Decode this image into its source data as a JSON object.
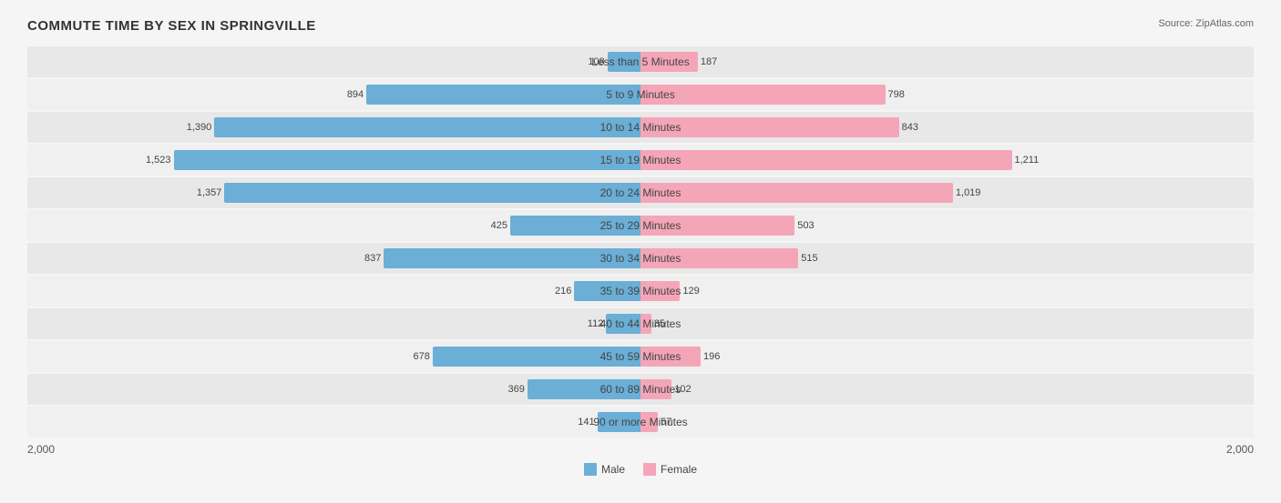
{
  "title": "COMMUTE TIME BY SEX IN SPRINGVILLE",
  "source": "Source: ZipAtlas.com",
  "maxValue": 2000,
  "leftAxisLabel": "2,000",
  "rightAxisLabel": "2,000",
  "legendMale": "Male",
  "legendFemale": "Female",
  "rows": [
    {
      "label": "Less than 5 Minutes",
      "male": 108,
      "female": 187
    },
    {
      "label": "5 to 9 Minutes",
      "male": 894,
      "female": 798
    },
    {
      "label": "10 to 14 Minutes",
      "male": 1390,
      "female": 843
    },
    {
      "label": "15 to 19 Minutes",
      "male": 1523,
      "female": 1211
    },
    {
      "label": "20 to 24 Minutes",
      "male": 1357,
      "female": 1019
    },
    {
      "label": "25 to 29 Minutes",
      "male": 425,
      "female": 503
    },
    {
      "label": "30 to 34 Minutes",
      "male": 837,
      "female": 515
    },
    {
      "label": "35 to 39 Minutes",
      "male": 216,
      "female": 129
    },
    {
      "label": "40 to 44 Minutes",
      "male": 112,
      "female": 35
    },
    {
      "label": "45 to 59 Minutes",
      "male": 678,
      "female": 196
    },
    {
      "label": "60 to 89 Minutes",
      "male": 369,
      "female": 102
    },
    {
      "label": "90 or more Minutes",
      "male": 141,
      "female": 57
    }
  ]
}
